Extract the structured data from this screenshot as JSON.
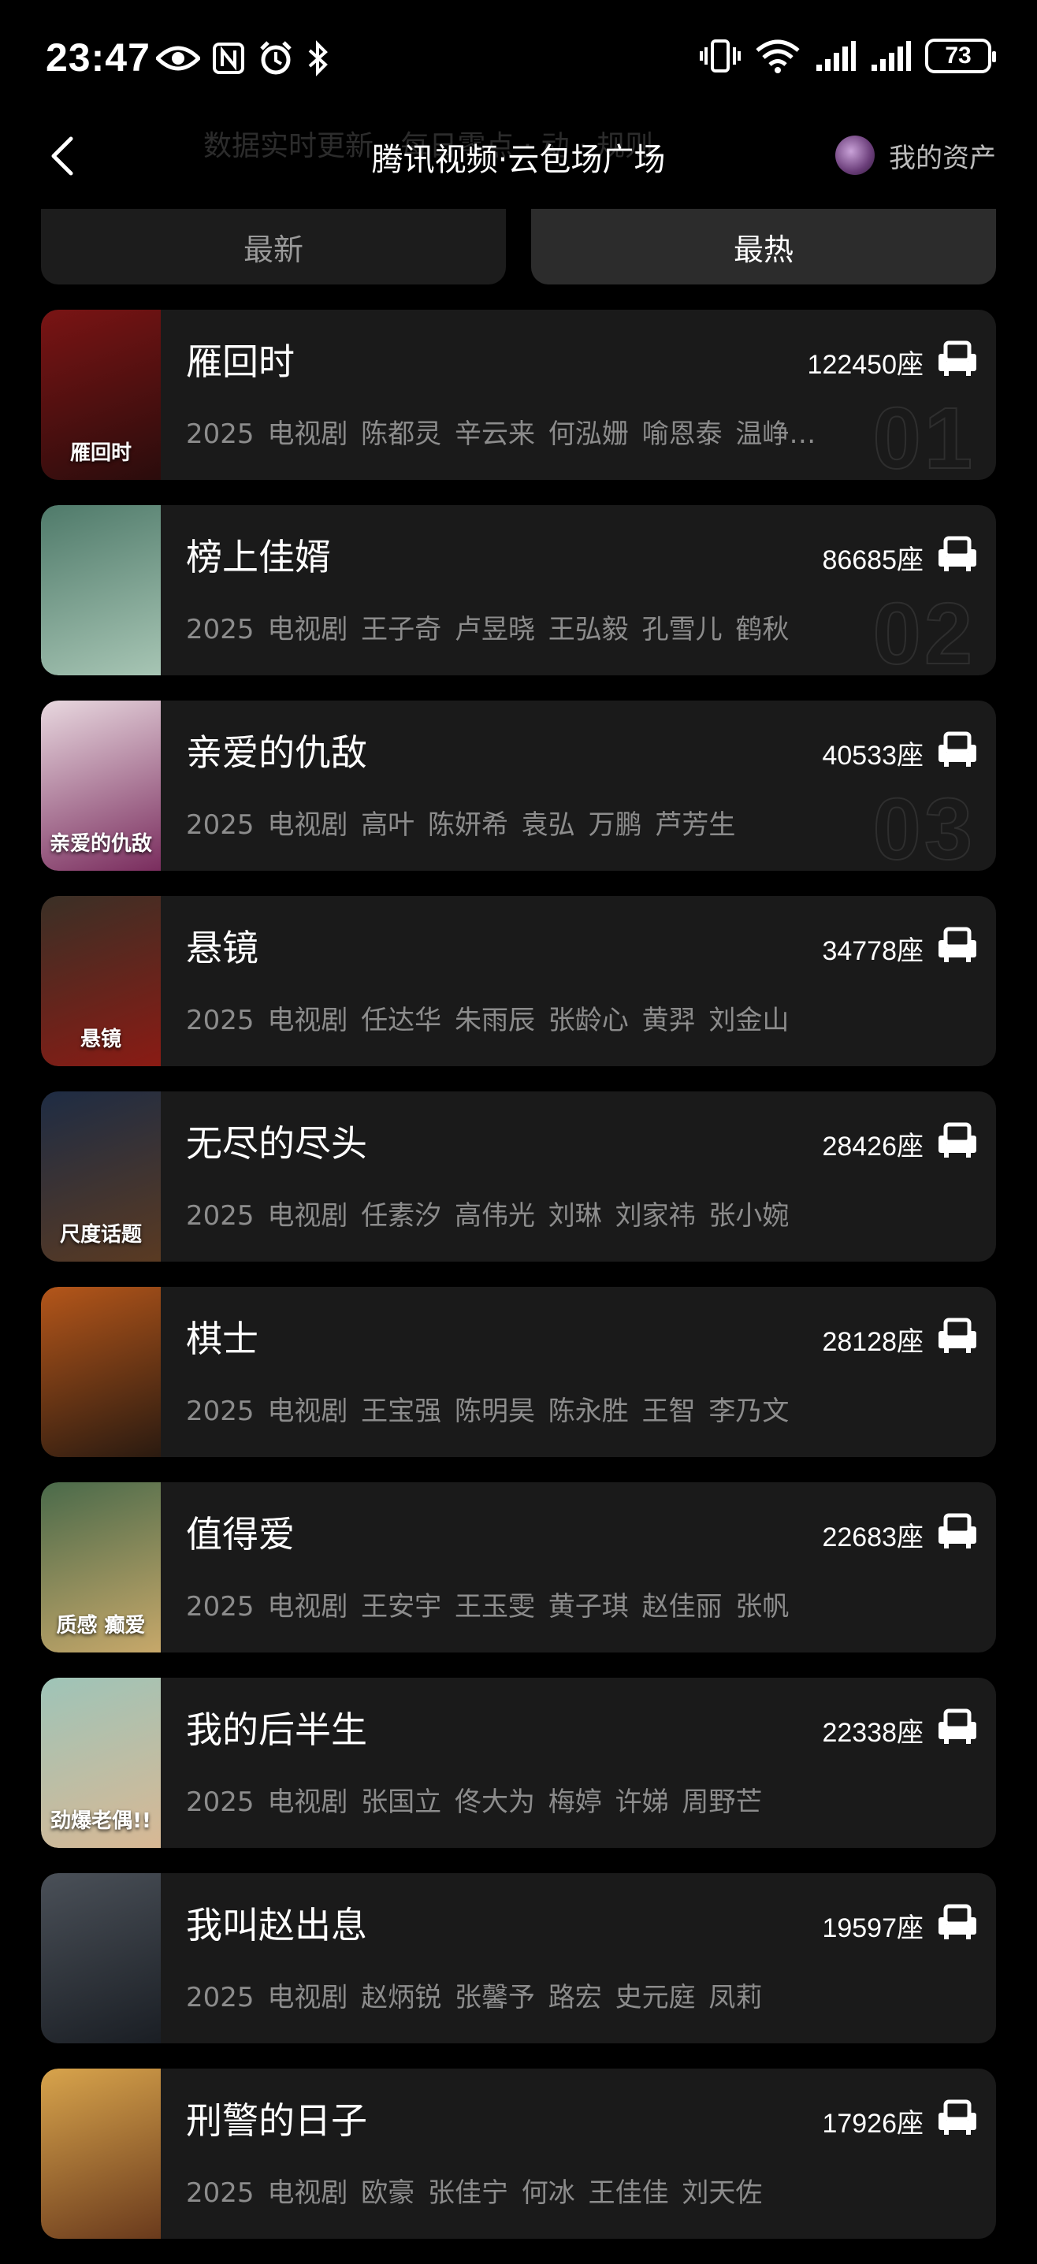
{
  "status_bar": {
    "time": "23:47",
    "battery": "73"
  },
  "header": {
    "ghost_text": "数据实时更新 · 每日零点 · 动 · 规则",
    "title": "腾讯视频·云包场广场",
    "assets_label": "我的资产"
  },
  "tabs": [
    {
      "label": "最新",
      "active": false
    },
    {
      "label": "最热",
      "active": true
    }
  ],
  "items": [
    {
      "title": "雁回时",
      "seats": "122450座",
      "meta": "2025 电视剧 陈都灵 辛云来 何泓姗 喻恩泰 温峥…",
      "rank": "01",
      "poster_text": "雁回时",
      "poster_colors": [
        "#7a1414",
        "#2a0c0c"
      ]
    },
    {
      "title": "榜上佳婿",
      "seats": "86685座",
      "meta": "2025 电视剧 王子奇 卢昱晓 王弘毅 孔雪儿 鹤秋",
      "rank": "02",
      "poster_text": "",
      "poster_colors": [
        "#4f7a6a",
        "#a7c5b4"
      ]
    },
    {
      "title": "亲爱的仇敌",
      "seats": "40533座",
      "meta": "2025 电视剧 高叶 陈妍希 袁弘 万鹏 芦芳生",
      "rank": "03",
      "poster_text": "亲爱的仇敌",
      "poster_colors": [
        "#e8d8df",
        "#7a2d5e"
      ]
    },
    {
      "title": "悬镜",
      "seats": "34778座",
      "meta": "2025 电视剧 任达华 朱雨辰 张龄心 黄羿 刘金山",
      "rank": "",
      "poster_text": "悬镜",
      "poster_colors": [
        "#3a3026",
        "#8a1b14"
      ]
    },
    {
      "title": "无尽的尽头",
      "seats": "28426座",
      "meta": "2025 电视剧 任素汐 高伟光 刘琳 刘家祎 张小婉",
      "rank": "",
      "poster_text": "尺度话题",
      "poster_colors": [
        "#1e2c44",
        "#5a3a22"
      ]
    },
    {
      "title": "棋士",
      "seats": "28128座",
      "meta": "2025 电视剧 王宝强 陈明昊 陈永胜 王智 李乃文",
      "rank": "",
      "poster_text": "",
      "poster_colors": [
        "#b4561a",
        "#2a1a10"
      ]
    },
    {
      "title": "值得爱",
      "seats": "22683座",
      "meta": "2025 电视剧 王安宇 王玉雯 黄子琪 赵佳丽 张帆",
      "rank": "",
      "poster_text": "质感 癫爱",
      "poster_colors": [
        "#4a6a4a",
        "#c7a86a"
      ]
    },
    {
      "title": "我的后半生",
      "seats": "22338座",
      "meta": "2025 电视剧 张国立 佟大为 梅婷 许娣 周野芒",
      "rank": "",
      "poster_text": "劲爆老偶!!",
      "poster_colors": [
        "#9ec4b8",
        "#d8b894"
      ]
    },
    {
      "title": "我叫赵出息",
      "seats": "19597座",
      "meta": "2025 电视剧 赵炳锐 张馨予 路宏 史元庭 凤莉",
      "rank": "",
      "poster_text": "",
      "poster_colors": [
        "#4a5058",
        "#1a1e24"
      ]
    },
    {
      "title": "刑警的日子",
      "seats": "17926座",
      "meta": "2025 电视剧 欧豪 张佳宁 何冰 王佳佳 刘天佐",
      "rank": "",
      "poster_text": "",
      "poster_colors": [
        "#d8a44c",
        "#6a3a1c"
      ]
    }
  ]
}
